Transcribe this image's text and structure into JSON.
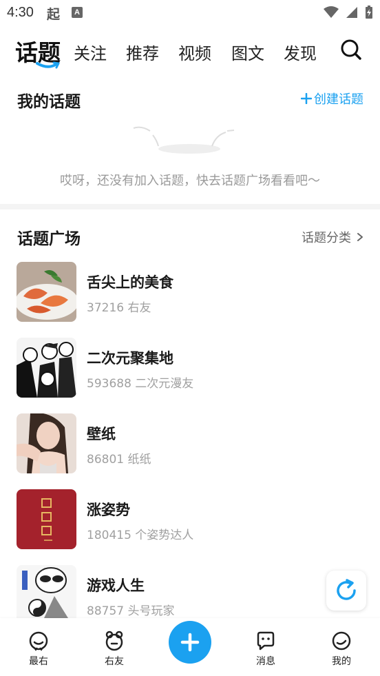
{
  "status_bar": {
    "time": "4:30",
    "app_icon_1": "起",
    "app_icon_2": "A"
  },
  "top_nav": {
    "current": "话题",
    "tabs": [
      "关注",
      "推荐",
      "视频",
      "图文",
      "发现"
    ],
    "search_icon": "search-icon"
  },
  "my_topics": {
    "title": "我的话题",
    "create_label": "创建话题",
    "empty_text": "哎呀，还没有加入话题，快去话题广场看看吧～"
  },
  "square": {
    "title": "话题广场",
    "category_label": "话题分类",
    "topics": [
      {
        "name": "舌尖上的美食",
        "meta": "37216 右友"
      },
      {
        "name": "二次元聚集地",
        "meta": "593688 二次元漫友"
      },
      {
        "name": "壁纸",
        "meta": "86801 纸纸"
      },
      {
        "name": "涨姿势",
        "meta": "180415 个姿势达人"
      },
      {
        "name": "游戏人生",
        "meta": "88757 头号玩家"
      }
    ]
  },
  "bottom_nav": {
    "items": [
      {
        "label": "最右"
      },
      {
        "label": "右友"
      },
      {
        "label": "消息"
      },
      {
        "label": "我的"
      }
    ]
  },
  "colors": {
    "accent": "#1ba1f0",
    "text_primary": "#1a1a1a",
    "text_secondary": "#a0a0a0"
  }
}
